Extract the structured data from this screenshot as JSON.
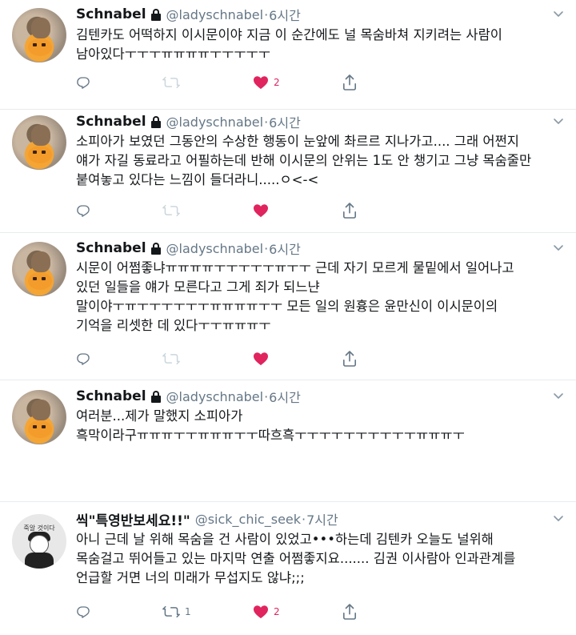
{
  "tweets": [
    {
      "author": {
        "name": "Schnabel",
        "handle": "@ladyschnabel",
        "protected": true
      },
      "time": "6시간",
      "lines": [
        "김텐카도 어떡하지 이시문이야 지금 이 순간에도 널 목숨바쳐 지키려는 사람이",
        "남아있다ㅜㅜㅜㅠㅠㅠㅠㅜㅜㅜㅜㅜ"
      ],
      "reply_count": "",
      "retweet_count": "",
      "like_count": "2",
      "liked": true
    },
    {
      "author": {
        "name": "Schnabel",
        "handle": "@ladyschnabel",
        "protected": true
      },
      "time": "6시간",
      "lines": [
        "소피아가 보였던 그동안의 수상한 행동이 눈앞에 촤르르 지나가고.... 그래 어쩐지",
        "얘가 자길 동료라고 어필하는데 반해 이시문의 안위는 1도 안 챙기고 그냥 목숨줄만",
        "붙여놓고 있다는 느낌이 들더라니.....ㅇ<-<"
      ],
      "reply_count": "",
      "retweet_count": "",
      "like_count": "",
      "liked": true
    },
    {
      "author": {
        "name": "Schnabel",
        "handle": "@ladyschnabel",
        "protected": true
      },
      "time": "6시간",
      "lines": [
        "시문이 어쩜좋냐ㅠㅠㅠㅠㅜㅜㅜㅜㅜㅠㅜㅜ 근데 자기 모르게 물밑에서 일어나고",
        "있던 일들을 얘가 모른다고 그게 죄가 되느냔",
        "말이야ㅜㅠㅜㅜㅜㅜㅜㅜㅠㅠㅠㅠㅜㅜ 모든 일의 원흉은 윤만신이 이시문이의",
        "기억을 리셋한 데 있다ㅜㅜㅠㅠㅠㅜ"
      ],
      "reply_count": "",
      "retweet_count": "",
      "like_count": "",
      "liked": true
    },
    {
      "author": {
        "name": "Schnabel",
        "handle": "@ladyschnabel",
        "protected": true
      },
      "time": "6시간",
      "lines": [
        "여러분...제가 말했지 소피아가",
        "흑막이라구ㅠㅠㅠㅜㅜㅠㅠㅠㅜㅜ따흐흑ㅜㅜㅜㅜㅜㅜㅜㅜㅜㅜㅠㅠㅠㅜ"
      ],
      "reply_count": "",
      "retweet_count": "",
      "like_count": "",
      "liked": false,
      "show_actions": false
    },
    {
      "author": {
        "name": "씩\"특영반보세요!!\"",
        "handle": "@sick_chic_seek",
        "protected": false,
        "avatar_caption": "죽알 것이다"
      },
      "time": "7시간",
      "lines": [
        "아니 근데 날 위해 목숨을 건 사람이 있었고•••하는데 김텐카 오늘도 널위해",
        "목숨걸고 뛰어들고 있는 마지막 연출 어쩜좋지요....... 김권 이사람아 인과관계를",
        "언급할 거면 너의 미래가 무섭지도 않냐;;;"
      ],
      "reply_count": "",
      "retweet_count": "1",
      "like_count": "2",
      "liked": true
    }
  ],
  "icons": {
    "reply": "reply-icon",
    "retweet": "retweet-icon",
    "like": "heart-icon",
    "share": "share-icon",
    "lock": "lock-icon",
    "caret": "chevron-down-icon"
  },
  "colors": {
    "like": "#e0245e",
    "icon_gray": "#657786",
    "retweet_inactive": "#ccd6dd",
    "divider": "#e6ecf0"
  }
}
